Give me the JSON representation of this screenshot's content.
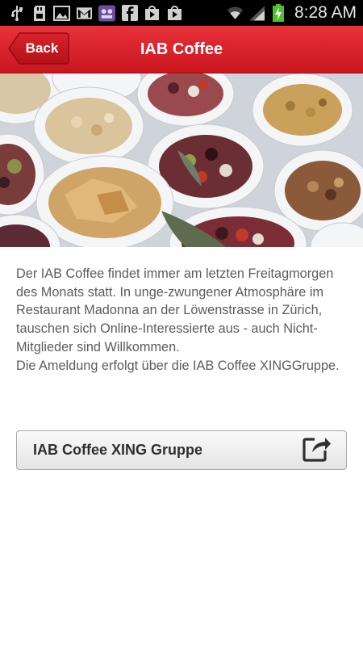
{
  "status_bar": {
    "time": "8:28 AM",
    "icons": [
      "usb-icon",
      "sd-card-icon",
      "image-icon",
      "gmail-icon",
      "app-icon",
      "facebook-icon",
      "play-store-icon",
      "play-icon",
      "wifi-icon",
      "signal-icon",
      "battery-charging-icon"
    ]
  },
  "action_bar": {
    "back_label": "Back",
    "title": "IAB Coffee",
    "color": "#d62029"
  },
  "content": {
    "paragraph_1": "Der IAB Coffee findet immer am letzten Freitagmorgen des Monats statt. In unge-zwungener Atmosphäre im Restaurant Madonna an der Löwenstrasse in Zürich, tauschen sich Online-Interessierte aus - auch Nicht-Mitglieder sind Willkommen.",
    "paragraph_2": "Die Ameldung erfolgt über die IAB Coffee XINGGruppe.",
    "link_button_label": "IAB Coffee XING Gruppe",
    "link_icon": "external-link-icon"
  }
}
